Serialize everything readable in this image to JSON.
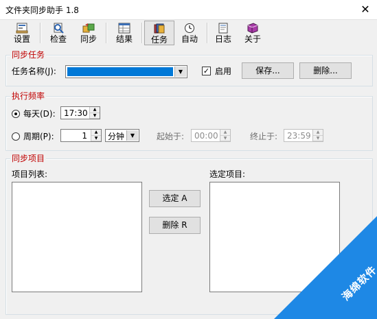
{
  "window": {
    "title": "文件夹同步助手 1.8",
    "close_glyph": "✕"
  },
  "toolbar": {
    "items": [
      {
        "label": "设置",
        "icon": "settings-icon"
      },
      {
        "label": "检查",
        "icon": "check-icon"
      },
      {
        "label": "同步",
        "icon": "sync-icon"
      },
      {
        "label": "结果",
        "icon": "results-icon"
      },
      {
        "label": "任务",
        "icon": "task-icon",
        "active": true
      },
      {
        "label": "自动",
        "icon": "clock-icon"
      },
      {
        "label": "日志",
        "icon": "log-icon"
      },
      {
        "label": "关于",
        "icon": "about-icon"
      }
    ]
  },
  "sync_task": {
    "group_title": "同步任务",
    "task_name_label": "任务名称(J):",
    "task_name_value": "",
    "enable_label": "启用",
    "enable_checked": true,
    "save_button": "保存...",
    "delete_button": "删除..."
  },
  "frequency": {
    "group_title": "执行频率",
    "daily_label": "每天(D):",
    "daily_selected": true,
    "daily_time": "17:30",
    "period_label": "周期(P):",
    "period_value": "1",
    "period_unit": "分钟",
    "start_label": "起始于:",
    "start_time": "00:00",
    "end_label": "终止于:",
    "end_time": "23:59"
  },
  "sync_items": {
    "group_title": "同步项目",
    "list_label": "项目列表:",
    "selected_label": "选定项目:",
    "select_button": "选定 A",
    "remove_button": "删除 R"
  },
  "watermark": {
    "text": "海绵软件"
  },
  "colors": {
    "accent_red": "#c00000",
    "selection_blue": "#0078d7",
    "watermark_blue": "#1e88e5"
  }
}
